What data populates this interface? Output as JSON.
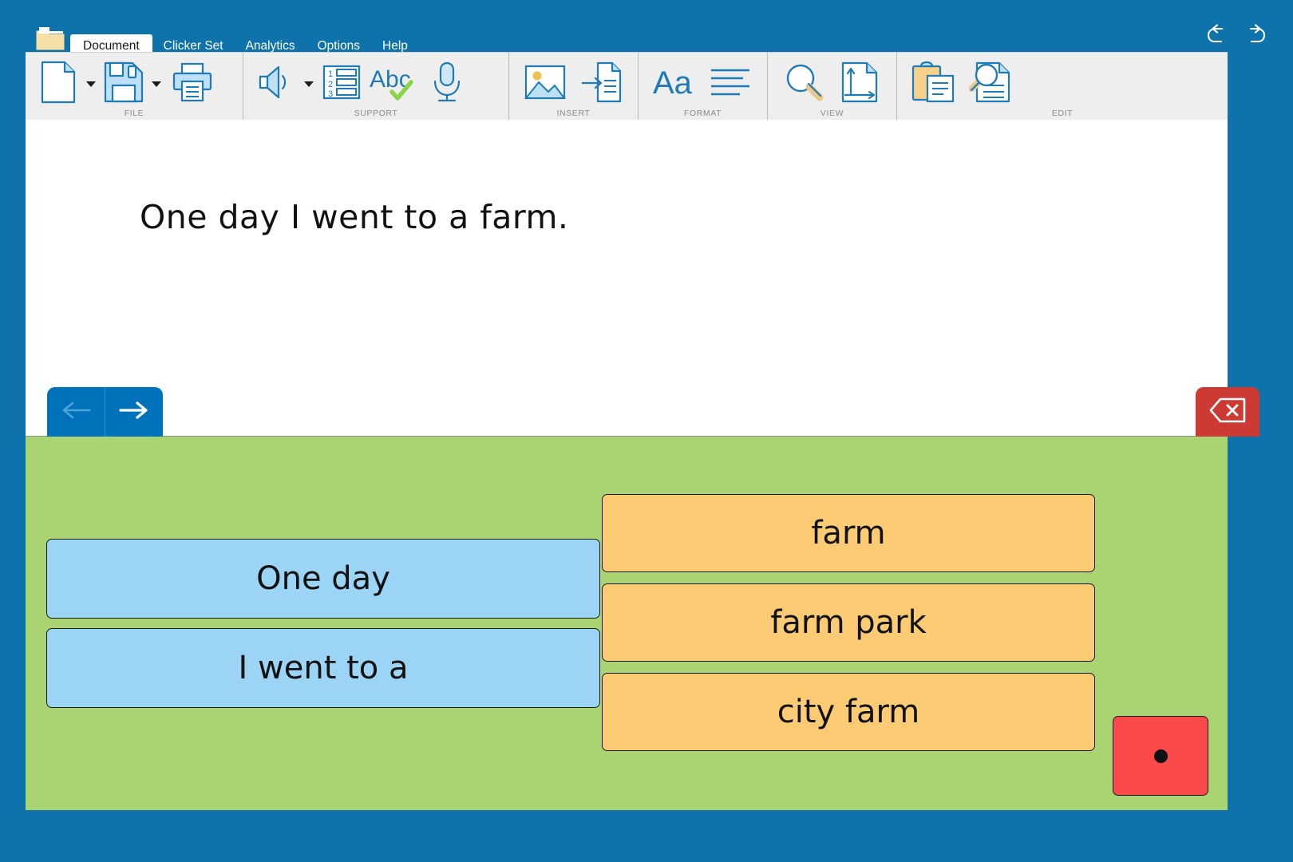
{
  "window": {
    "app_icon": "folder-icon",
    "menu_tabs": [
      {
        "label": "Document",
        "active": true
      },
      {
        "label": "Clicker Set",
        "active": false
      },
      {
        "label": "Analytics",
        "active": false
      },
      {
        "label": "Options",
        "active": false
      },
      {
        "label": "Help",
        "active": false
      }
    ],
    "title_actions": [
      {
        "name": "undo-button",
        "icon": "undo-icon"
      },
      {
        "name": "redo-button",
        "icon": "redo-icon"
      }
    ]
  },
  "ribbon": {
    "groups": [
      {
        "label": "FILE",
        "buttons": [
          {
            "name": "new-document-button",
            "icon": "new-document-icon",
            "has_caret": true
          },
          {
            "name": "save-button",
            "icon": "floppy-disk-icon",
            "has_caret": true
          },
          {
            "name": "print-button",
            "icon": "printer-icon",
            "has_caret": false
          }
        ]
      },
      {
        "label": "SUPPORT",
        "buttons": [
          {
            "name": "speak-button",
            "icon": "speaker-icon",
            "has_caret": true
          },
          {
            "name": "word-list-button",
            "icon": "numbered-list-icon",
            "has_caret": false
          },
          {
            "name": "spell-check-button",
            "icon": "spell-check-abc-icon",
            "has_caret": false
          },
          {
            "name": "voice-record-button",
            "icon": "microphone-icon",
            "has_caret": false
          }
        ]
      },
      {
        "label": "INSERT",
        "buttons": [
          {
            "name": "insert-picture-button",
            "icon": "picture-icon",
            "has_caret": false
          },
          {
            "name": "insert-page-button",
            "icon": "insert-into-document-icon",
            "has_caret": false
          }
        ]
      },
      {
        "label": "FORMAT",
        "buttons": [
          {
            "name": "font-button",
            "icon": "font-aa-icon",
            "has_caret": false
          },
          {
            "name": "paragraph-align-button",
            "icon": "align-lines-icon",
            "has_caret": false
          }
        ]
      },
      {
        "label": "VIEW",
        "buttons": [
          {
            "name": "zoom-button",
            "icon": "magnifier-icon",
            "has_caret": false
          },
          {
            "name": "page-layout-button",
            "icon": "page-orientation-icon",
            "has_caret": false
          }
        ]
      },
      {
        "label": "EDIT",
        "buttons": [
          {
            "name": "paste-button",
            "icon": "clipboard-paste-icon",
            "has_caret": false
          },
          {
            "name": "find-button",
            "icon": "find-in-document-icon",
            "has_caret": false
          }
        ]
      }
    ]
  },
  "document": {
    "text": "One day I went to a farm."
  },
  "navigation": {
    "back": {
      "icon": "arrow-left-icon",
      "enabled": false
    },
    "forward": {
      "icon": "arrow-right-icon",
      "enabled": true
    },
    "delete": {
      "icon": "backspace-delete-icon"
    }
  },
  "word_grid": {
    "left_column": [
      {
        "label": "One day",
        "color": "blue"
      },
      {
        "label": "I went to a",
        "color": "blue"
      }
    ],
    "right_column": [
      {
        "label": "farm",
        "color": "orange"
      },
      {
        "label": "farm park",
        "color": "orange"
      },
      {
        "label": "city farm",
        "color": "orange"
      }
    ],
    "punctuation": {
      "label": ".",
      "color": "red"
    }
  },
  "colors": {
    "window_chrome": "#0E72AB",
    "ribbon_bg": "#eeeeee",
    "panel_green": "#AAD472",
    "card_blue": "#9BD4F5",
    "card_orange": "#FCCB74",
    "card_red": "#FC4A4A",
    "nav_blue": "#0072BC",
    "delete_red": "#CD3A34",
    "icon_blue": "#1F7BB6"
  }
}
